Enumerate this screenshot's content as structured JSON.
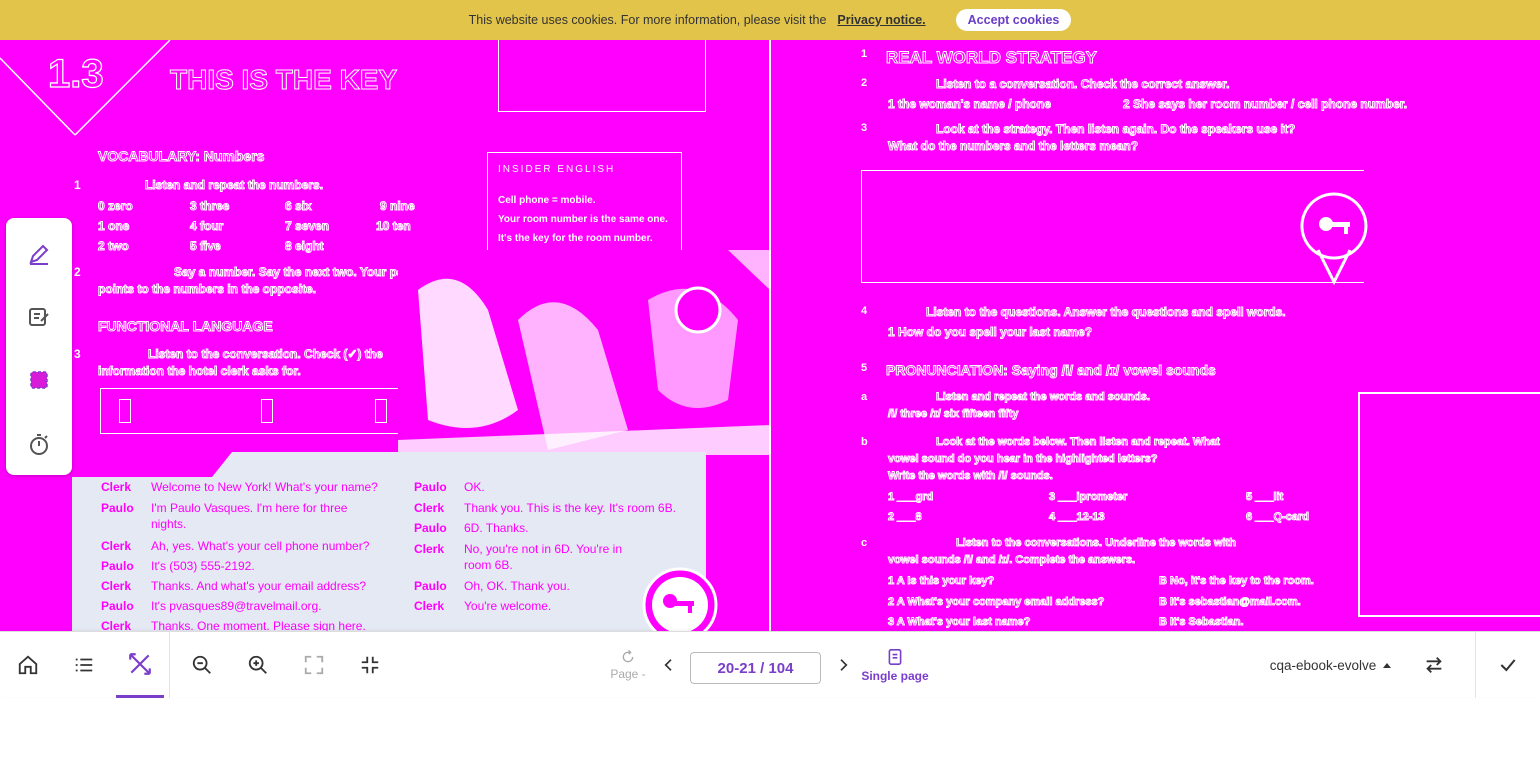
{
  "cookie_bar": {
    "message": "This website uses cookies. For more information, please visit the",
    "link": "Privacy notice.",
    "accept_label": "Accept cookies"
  },
  "left_page": {
    "unit_number": "1.3",
    "unit_title": "THIS IS THE KEY",
    "vocab_heading": "VOCABULARY: Numbers",
    "vocab_instruction": "Listen and repeat the numbers.",
    "numbers": [
      "0 zero",
      "1 one",
      "2 two",
      "3 three",
      "4 four",
      "5 five",
      "6 six",
      "7 seven",
      "8 eight",
      "9 nine",
      "10 ten"
    ],
    "ex2": "Say a number. Say the next two. Your partner",
    "ex2_b": "points to the numbers in the opposite.",
    "insider_label": "INSIDER ENGLISH",
    "insider_l1": "Cell phone = mobile.",
    "insider_l2": "Your room number is the same one.",
    "insider_l3": "It's the key for the room number.",
    "functional_heading": "FUNCTIONAL LANGUAGE",
    "ex3": "Listen to the conversation. Check (✓) the",
    "ex3_b": "information the hotel clerk asks for.",
    "dialog": [
      {
        "speaker": "Clerk",
        "line": "Welcome to New York! What's your name?"
      },
      {
        "speaker": "Paulo",
        "line": "I'm Paulo Vasques. I'm here for three nights."
      },
      {
        "speaker": "Clerk",
        "line": "Ah, yes. What's your cell phone number?"
      },
      {
        "speaker": "Paulo",
        "line": "It's (503) 555-2192."
      },
      {
        "speaker": "Clerk",
        "line": "Thanks. And what's your email address?"
      },
      {
        "speaker": "Paulo",
        "line": "It's pvasques89@travelmail.org."
      },
      {
        "speaker": "Clerk",
        "line": "Thanks. One moment. Please sign here."
      }
    ],
    "dialog_right": [
      {
        "speaker": "Paulo",
        "line": "OK."
      },
      {
        "speaker": "Clerk",
        "line": "Thank you. This is the key. It's room 6B."
      },
      {
        "speaker": "Paulo",
        "line": "6D. Thanks."
      },
      {
        "speaker": "Clerk",
        "line": "No, you're not in 6D. You're in room 6B."
      },
      {
        "speaker": "Paulo",
        "line": "Oh, OK. Thank you."
      },
      {
        "speaker": "Clerk",
        "line": "You're welcome."
      }
    ]
  },
  "right_page": {
    "heading": "REAL WORLD STRATEGY",
    "ex_a": "Listen to a conversation. Check the correct answer.",
    "ex_a1": "1  the woman's name / phone",
    "ex_a2": "2  She says her room number / cell phone number.",
    "ex_b": "Look at the strategy. Then listen again. Do the speakers use it?",
    "ex_b2": "What do the numbers and the letters mean?",
    "ex_c": "Listen to the questions. Answer the questions and spell words.",
    "ex_c1": "1  How do you spell your last name?",
    "pron_heading": "PRONUNCIATION: Saying /i/ and /ɪ/ vowel sounds",
    "ex_p1": "Listen and repeat the words and sounds.",
    "ex_p2": "/i/  three   /ɪ/  six   fifteen   fifty",
    "ex_p3": "Look at the words below. Then listen and repeat. What",
    "ex_p4": "vowel sound do you hear in the highlighted letters?",
    "ex_p5": "Write the words with /i/ sounds.",
    "words": [
      "1 ___grd",
      "2 ___8",
      "3 ___iprometer",
      "4 ___12-13",
      "5 ___lit",
      "6 ___Q-card"
    ],
    "ex_q": "Listen to the conversations. Underline the words with",
    "ex_q2": "vowel sounds /i/ and /ɪ/. Complete the answers.",
    "answers": [
      "1  A  Is this your key?",
      "2  A  What's your company email address?",
      "3  A  What's your last name?"
    ],
    "answers_b": [
      "B  No, it's the key to the room.",
      "B  It's sebastian@mail.com.",
      "B  It's Sebastian."
    ]
  },
  "tools": [
    {
      "icon": "pen-icon"
    },
    {
      "icon": "note-icon"
    },
    {
      "icon": "highlight-box-icon"
    },
    {
      "icon": "timer-icon"
    }
  ],
  "bottom_bar": {
    "page_label": "Page -",
    "page_value": "20-21 / 104",
    "single_page_label": "Single page",
    "book_name": "cqa-ebook-evolve",
    "accent_color": "#7a3ecb"
  }
}
